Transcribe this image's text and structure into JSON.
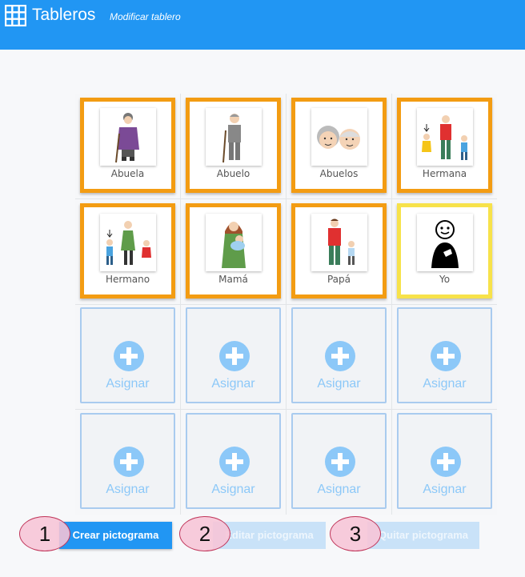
{
  "header": {
    "title": "Tableros",
    "subtitle": "Modificar tablero",
    "grid_icon": "grid-icon",
    "color": "#2196f3"
  },
  "board": {
    "pictograms": [
      {
        "label": "Abuela",
        "border": "orange",
        "icon": "grandmother-icon"
      },
      {
        "label": "Abuelo",
        "border": "orange",
        "icon": "grandfather-icon"
      },
      {
        "label": "Abuelos",
        "border": "orange",
        "icon": "grandparents-icon"
      },
      {
        "label": "Hermana",
        "border": "orange",
        "icon": "sister-icon"
      },
      {
        "label": "Hermano",
        "border": "orange",
        "icon": "brother-icon"
      },
      {
        "label": "Mamá",
        "border": "orange",
        "icon": "mother-icon"
      },
      {
        "label": "Papá",
        "border": "orange",
        "icon": "father-icon"
      },
      {
        "label": "Yo",
        "border": "yellow",
        "icon": "me-icon"
      }
    ],
    "empty_label": "Asignar",
    "empty_icon": "plus-circle-icon",
    "empty_count": 8
  },
  "actions": {
    "create": "Crear pictograma",
    "edit": "Editar pictograma",
    "remove": "Quitar pictograma"
  },
  "markers": [
    "1",
    "2",
    "3"
  ],
  "colors": {
    "primary": "#2196f3",
    "orange_border": "#f39c12",
    "yellow_border": "#f7e24a",
    "assign_blue": "#8cc8f8"
  }
}
